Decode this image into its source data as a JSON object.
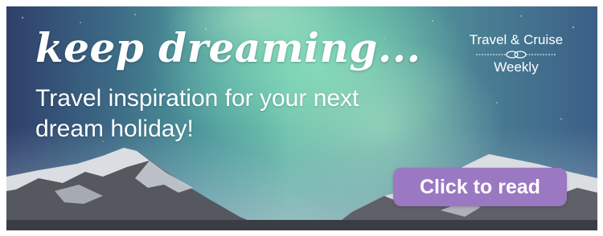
{
  "banner": {
    "headline": "keep dreaming...",
    "tagline": "Travel inspiration for your next dream holiday!",
    "logo": {
      "line1": "Travel & Cruise",
      "line2": "Weekly"
    },
    "cta_label": "Click to read",
    "colors": {
      "button": "#9b78c2",
      "text": "#ffffff",
      "aurora": "#63b8a6"
    }
  }
}
